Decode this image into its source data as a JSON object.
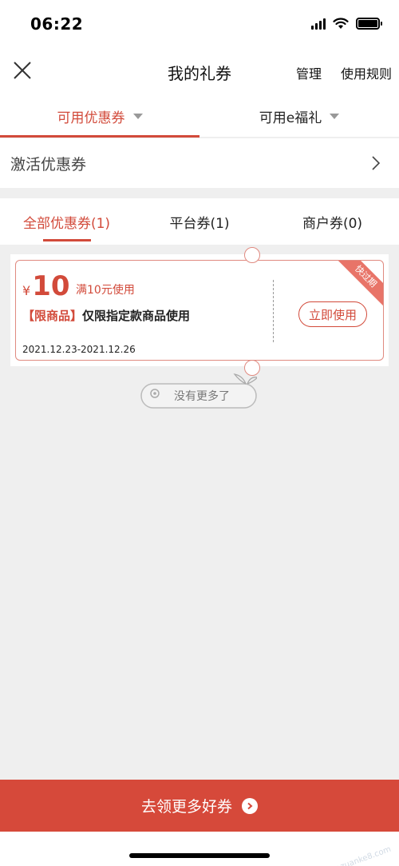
{
  "status_bar": {
    "time": "06:22"
  },
  "nav": {
    "title": "我的礼券",
    "manage": "管理",
    "rules": "使用规则"
  },
  "top_tabs": [
    {
      "label": "可用优惠券"
    },
    {
      "label": "可用e福礼"
    }
  ],
  "activate_row": {
    "label": "激活优惠券"
  },
  "filter_tabs": [
    {
      "label": "全部优惠券(1)"
    },
    {
      "label": "平台券(1)"
    },
    {
      "label": "商户券(0)"
    }
  ],
  "coupon": {
    "currency": "¥",
    "amount": "10",
    "condition": "满10元使用",
    "scope_tag": "【限商品】",
    "scope_text": "仅限指定款商品使用",
    "date_range": "2021.12.23-2021.12.26",
    "use_button": "立即使用",
    "ribbon": "快过期"
  },
  "no_more": "没有更多了",
  "bottom_button": "去领更多好券",
  "watermark": "赚客吧，有你一起赚！ www.zuanke8.com",
  "colors": {
    "accent": "#d24a3a",
    "coupon_border": "#e08a80",
    "background": "#efefef"
  }
}
